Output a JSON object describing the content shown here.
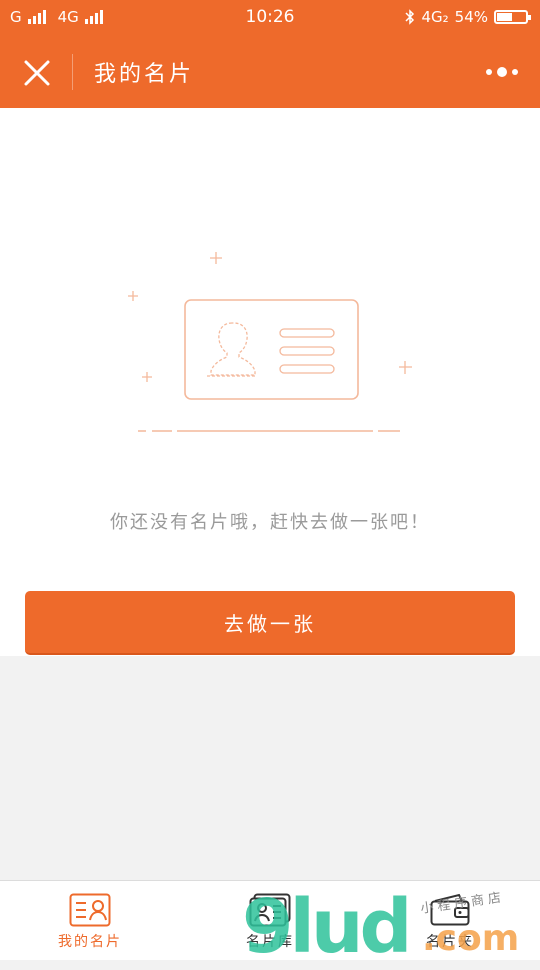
{
  "status_bar": {
    "carrier1": "G",
    "carrier2": "4G",
    "time": "10:26",
    "network": "4G₂",
    "battery": "54%",
    "battery_level": 0.54
  },
  "header": {
    "title": "我的名片",
    "background": "#ee6a2b"
  },
  "empty_state": {
    "message": "你还没有名片哦，赶快去做一张吧！",
    "button_label": "去做一张"
  },
  "tabbar": {
    "tabs": [
      {
        "label": "我的名片",
        "icon": "my-card-icon",
        "active": true
      },
      {
        "label": "名片库",
        "icon": "card-library-icon",
        "active": false
      },
      {
        "label": "名片夹",
        "icon": "card-holder-icon",
        "active": false
      }
    ],
    "active_color": "#ee6a2b"
  },
  "watermark": {
    "brand_letters": "9lud",
    "brand_suffix": ".com",
    "tagline": "小程序商店"
  }
}
